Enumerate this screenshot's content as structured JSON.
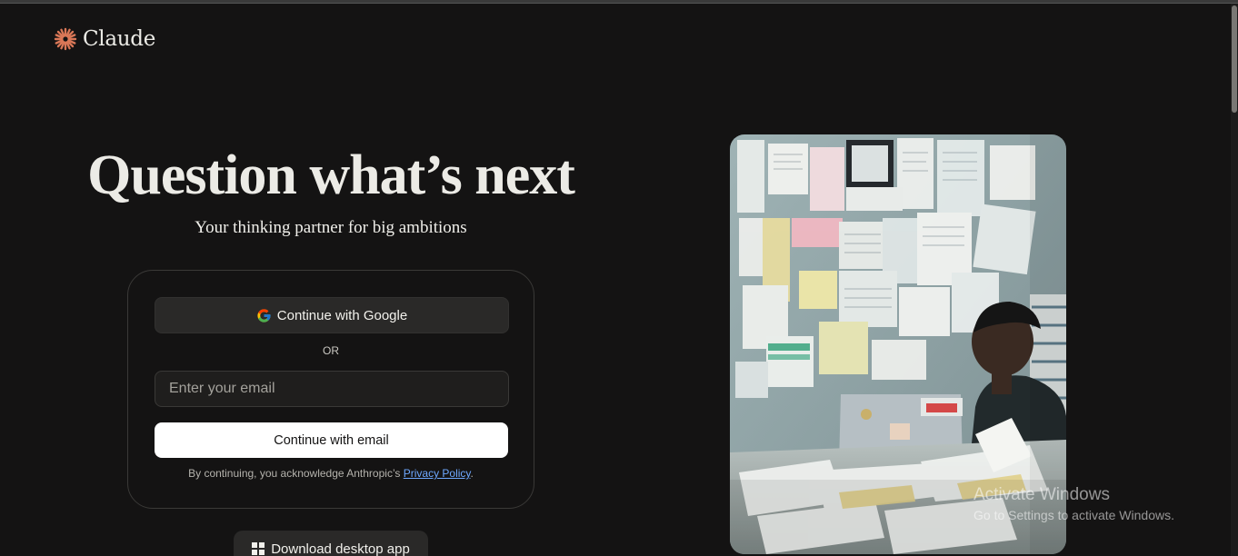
{
  "brand": {
    "name": "Claude",
    "accent": "#d97757"
  },
  "hero": {
    "headline": "Question what’s next",
    "subheadline": "Your thinking partner for big ambitions"
  },
  "auth": {
    "google_label": "Continue with Google",
    "divider": "OR",
    "email_placeholder": "Enter your email",
    "email_value": "",
    "email_button": "Continue with email",
    "legal_prefix": "By continuing, you acknowledge Anthropic’s ",
    "legal_link": "Privacy Policy",
    "legal_suffix": "."
  },
  "download": {
    "label": "Download desktop app"
  },
  "watermark": {
    "title": "Activate Windows",
    "subtitle": "Go to Settings to activate Windows."
  }
}
